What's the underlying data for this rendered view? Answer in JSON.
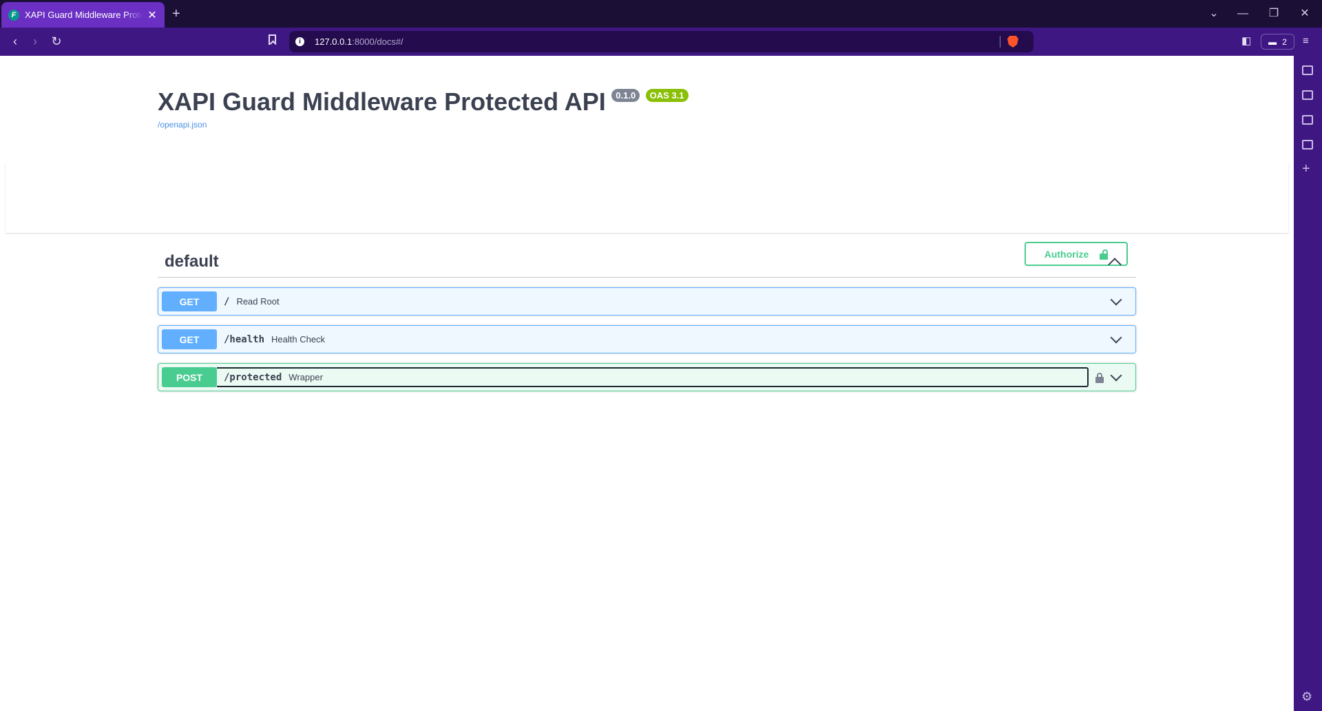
{
  "browser": {
    "tab_title": "XAPI Guard Middleware Protected API",
    "tab_favicon": "F",
    "url_host": "127.0.0.1",
    "url_rest": ":8000/docs#/",
    "shields_count": "2"
  },
  "info": {
    "title": "XAPI Guard Middleware Protected API",
    "version": "0.1.0",
    "oas": "OAS 3.1",
    "spec_link": "/openapi.json"
  },
  "auth": {
    "authorize_label": "Authorize"
  },
  "tag": {
    "name": "default",
    "operations": [
      {
        "method": "GET",
        "path": "/",
        "summary": "Read Root"
      },
      {
        "method": "GET",
        "path": "/health",
        "summary": "Health Check"
      },
      {
        "method": "POST",
        "path": "/protected",
        "summary": "Wrapper"
      }
    ]
  },
  "colors": {
    "get": "#61affe",
    "post": "#49cc90",
    "authorize": "#49cc90",
    "chrome": "#3e1783",
    "tabbar": "#1c0f35"
  }
}
